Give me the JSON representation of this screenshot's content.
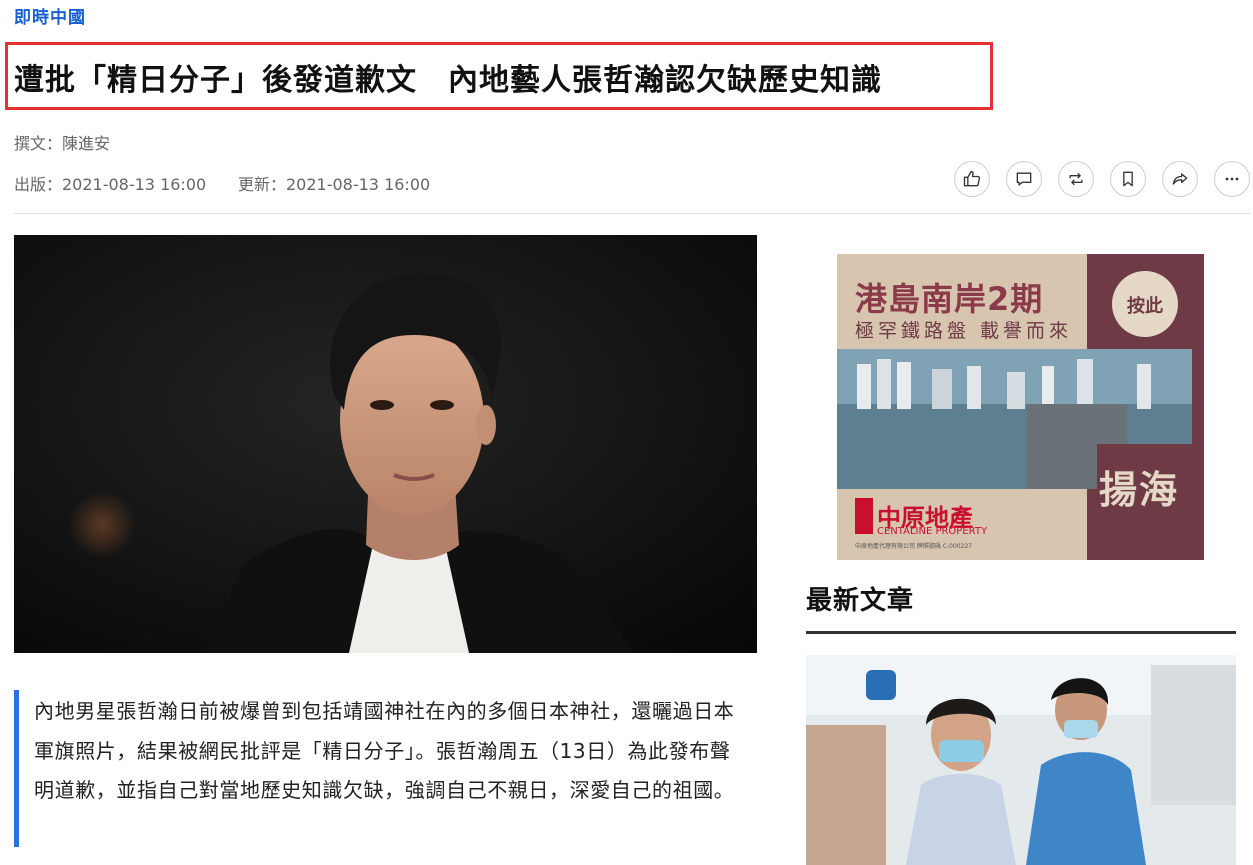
{
  "header": {
    "section": "即時中國",
    "title": "遭批「精日分子」後發道歉文　內地藝人張哲瀚認欠缺歷史知識"
  },
  "meta": {
    "author": "撰文：陳進安",
    "published": "出版：2021-08-13 16:00",
    "updated": "更新：2021-08-13 16:00"
  },
  "toolbar": {
    "icons": [
      "thumbs-up-icon",
      "comment-icon",
      "repost-icon",
      "bookmark-icon",
      "share-icon",
      "more-icon"
    ]
  },
  "article": {
    "lede": "內地男星張哲瀚日前被爆曾到包括靖國神社在內的多個日本神社，還曬過日本軍旗照片，結果被網民批評是「精日分子」。張哲瀚周五（13日）為此發布聲明道歉，並指自己對當地歷史知識欠缺，強調自己不親日，深愛自己的祖國。"
  },
  "ad": {
    "headline": "港島南岸2期",
    "subline": "極罕鐵路盤 載譽而來",
    "cta": "按此",
    "district": "揚海",
    "brand_zh": "中原地產",
    "brand_en": "CENTALINE PROPERTY",
    "fine_print": "中原地產代理有限公司 牌照號碼 C-000227",
    "colors": {
      "maroon": "#6e3a45",
      "beige": "#d8c5b0",
      "red": "#c8102e"
    }
  },
  "sidebar": {
    "heading": "最新文章"
  },
  "colors": {
    "accent_blue": "#1a5fd0",
    "highlight_red": "#e23232",
    "lede_bar": "#2e6ee6"
  }
}
